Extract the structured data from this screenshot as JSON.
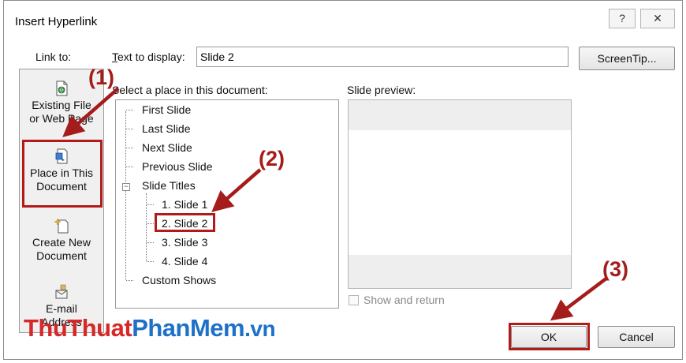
{
  "dialog": {
    "title": "Insert Hyperlink",
    "help_button": "?",
    "close_button": "✕"
  },
  "link_to": {
    "label": "Link to:",
    "items": [
      {
        "line1": "Existing File",
        "line2": "or Web Page",
        "icon": "existing-file-icon"
      },
      {
        "line1": "Place in This",
        "line2": "Document",
        "icon": "place-in-document-icon"
      },
      {
        "line1": "Create New",
        "line2": "Document",
        "icon": "create-new-document-icon"
      },
      {
        "line1": "E-mail",
        "line2": "Address",
        "icon": "email-icon"
      }
    ]
  },
  "text_to_display": {
    "label": "Text to display:",
    "value": "Slide 2"
  },
  "screentip_button": "ScreenTip...",
  "place_tree": {
    "label": "Select a place in this document:",
    "items": [
      "First Slide",
      "Last Slide",
      "Next Slide",
      "Previous Slide",
      "Slide Titles",
      "Custom Shows"
    ],
    "slide_titles": [
      "1. Slide 1",
      "2. Slide 2",
      "3. Slide 3",
      "4. Slide 4"
    ],
    "expander_symbol": "−"
  },
  "slide_preview": {
    "label": "Slide preview:"
  },
  "show_and_return": {
    "label": "Show and return",
    "checked": false
  },
  "ok_button": "OK",
  "cancel_button": "Cancel",
  "annotations": [
    "(1)",
    "(2)",
    "(3)"
  ],
  "annotation_color": "#a51c1c",
  "watermark": {
    "part1": "ThuThuat",
    "part2": "PhanMem",
    "part3": ".vn",
    "color1": "#d62828",
    "color2": "#1e70c8"
  }
}
